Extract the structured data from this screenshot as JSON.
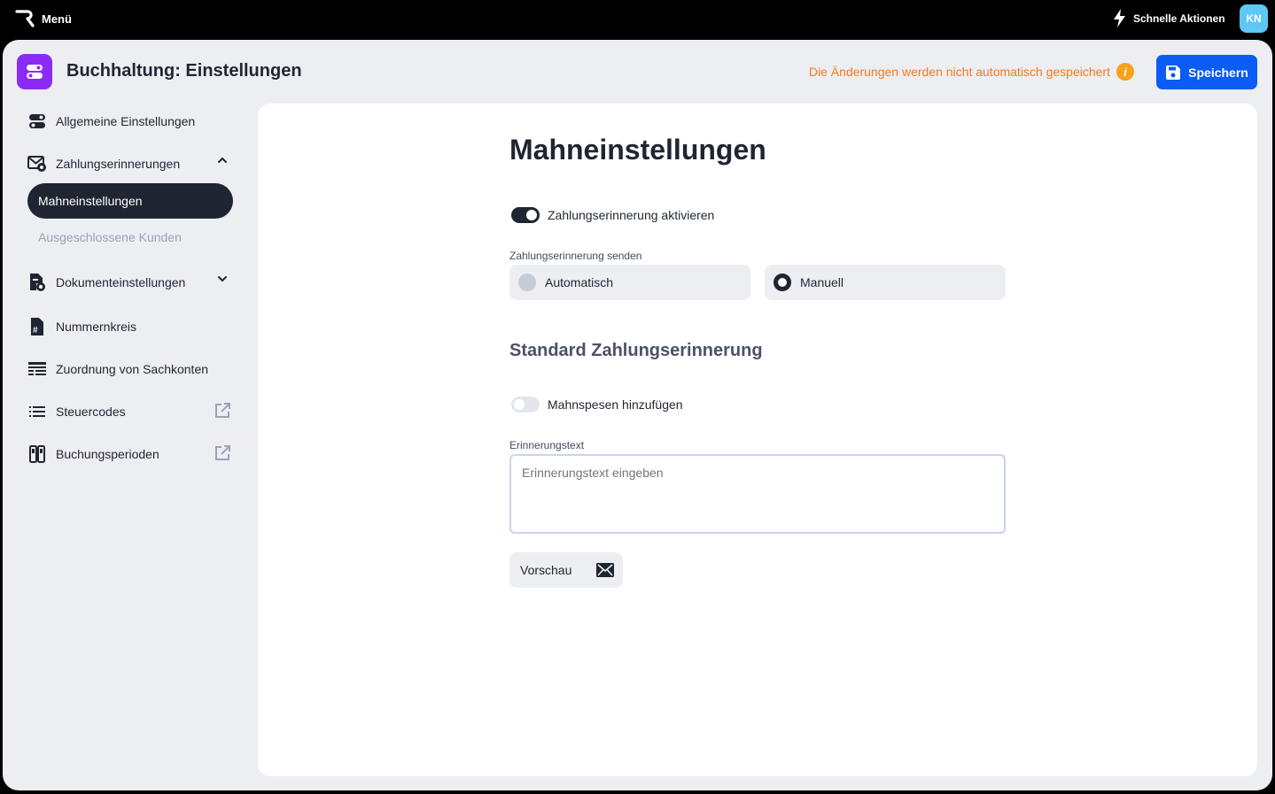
{
  "topbar": {
    "menu_label": "Menü",
    "quick_actions_label": "Schnelle Aktionen",
    "avatar_initials": "KN"
  },
  "header": {
    "title": "Buchhaltung: Einstellungen",
    "unsaved_notice": "Die Änderungen werden nicht automatisch gespeichert",
    "info_glyph": "i",
    "save_label": "Speichern"
  },
  "sidebar": {
    "items": [
      {
        "label": "Allgemeine Einstellungen",
        "icon": "toggles-icon"
      },
      {
        "label": "Zahlungserinnerungen",
        "icon": "mail-reminder-icon",
        "expanded": true
      },
      {
        "label": "Dokumenteinstellungen",
        "icon": "document-settings-icon",
        "expanded": false
      },
      {
        "label": "Nummernkreis",
        "icon": "hash-document-icon"
      },
      {
        "label": "Zuordnung von Sachkonten",
        "icon": "ledger-icon"
      },
      {
        "label": "Steuercodes",
        "icon": "list-icon",
        "external": true
      },
      {
        "label": "Buchungsperioden",
        "icon": "periods-icon",
        "external": true
      }
    ],
    "sub_items": [
      {
        "label": "Mahneinstellungen",
        "active": true
      },
      {
        "label": "Ausgeschlossene Kunden",
        "active": false
      }
    ]
  },
  "main": {
    "title": "Mahneinstellungen",
    "enable_toggle": {
      "label": "Zahlungserinnerung aktivieren",
      "on": true
    },
    "send_label": "Zahlungserinnerung senden",
    "send_options": [
      {
        "label": "Automatisch",
        "selected": false
      },
      {
        "label": "Manuell",
        "selected": true
      }
    ],
    "section_title": "Standard Zahlungserinnerung",
    "fees_toggle": {
      "label": "Mahnspesen hinzufügen",
      "on": false
    },
    "reminder_text_label": "Erinnerungstext",
    "reminder_text_placeholder": "Erinnerungstext eingeben",
    "reminder_text_value": "",
    "preview_label": "Vorschau"
  },
  "colors": {
    "accent": "#0b5bf5",
    "app_icon": "#8b2cf5",
    "warning": "#f37a1f",
    "dark": "#1f2532",
    "avatar": "#5cc8f3"
  }
}
